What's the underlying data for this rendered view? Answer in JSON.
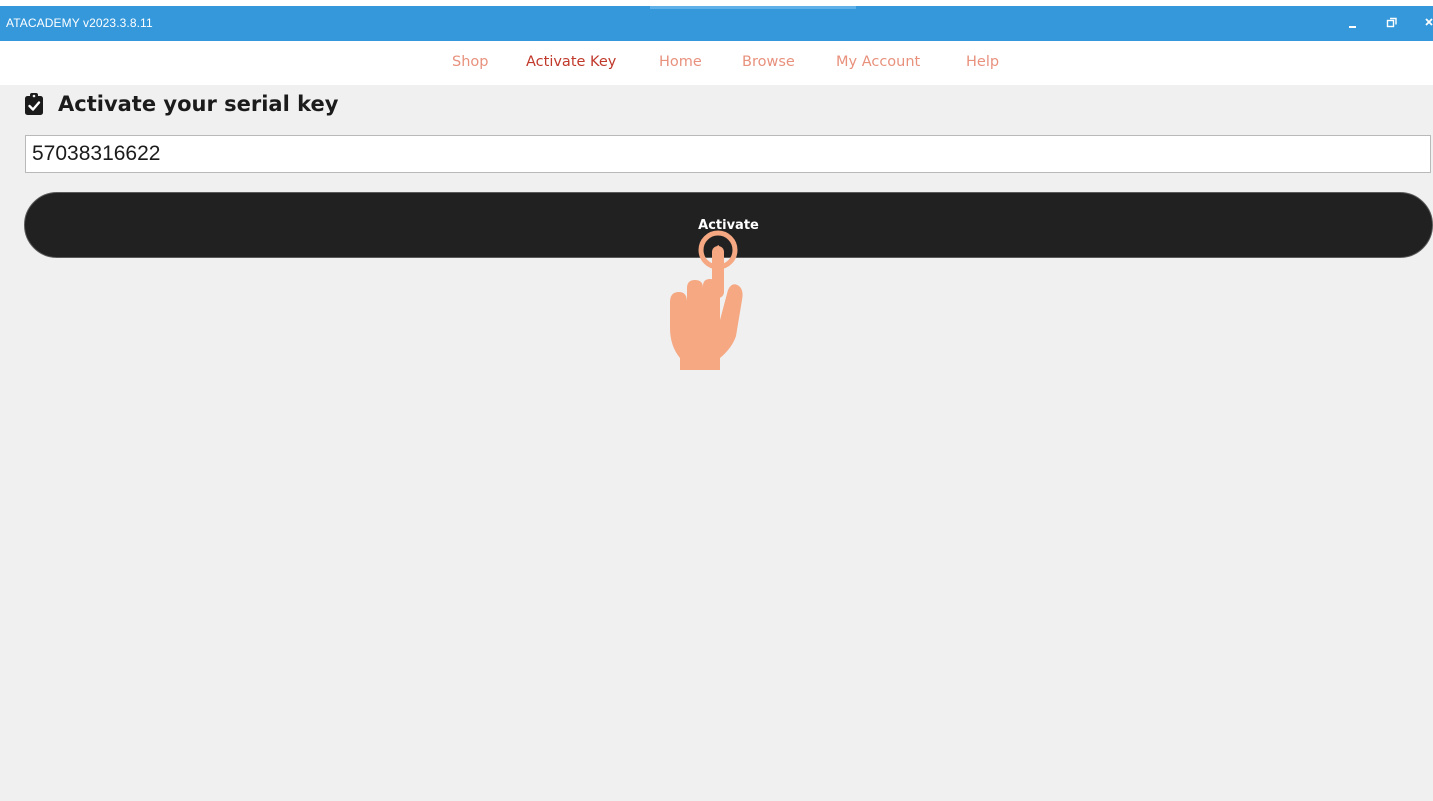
{
  "window": {
    "title": "ATACADEMY v2023.3.8.11",
    "controls": [
      "minimize-icon",
      "restore-icon",
      "close-icon"
    ]
  },
  "nav": {
    "items": [
      {
        "label": "Shop",
        "active": false
      },
      {
        "label": "Activate Key",
        "active": true
      },
      {
        "label": "Home",
        "active": false
      },
      {
        "label": "Browse",
        "active": false
      },
      {
        "label": "My Account",
        "active": false
      },
      {
        "label": "Help",
        "active": false
      }
    ]
  },
  "activation": {
    "heading": "Activate your serial key",
    "heading_icon": "clipboard-check-icon",
    "serial_value": "57038316622",
    "button_label": "Activate"
  },
  "overlay": {
    "icon": "tap-hand-icon"
  },
  "colors": {
    "title_bar": "#3498db",
    "nav_link": "#e8917d",
    "nav_link_active": "#c0392b",
    "button": "#212121",
    "background": "#f0f0f0",
    "hand": "#f5a882"
  }
}
